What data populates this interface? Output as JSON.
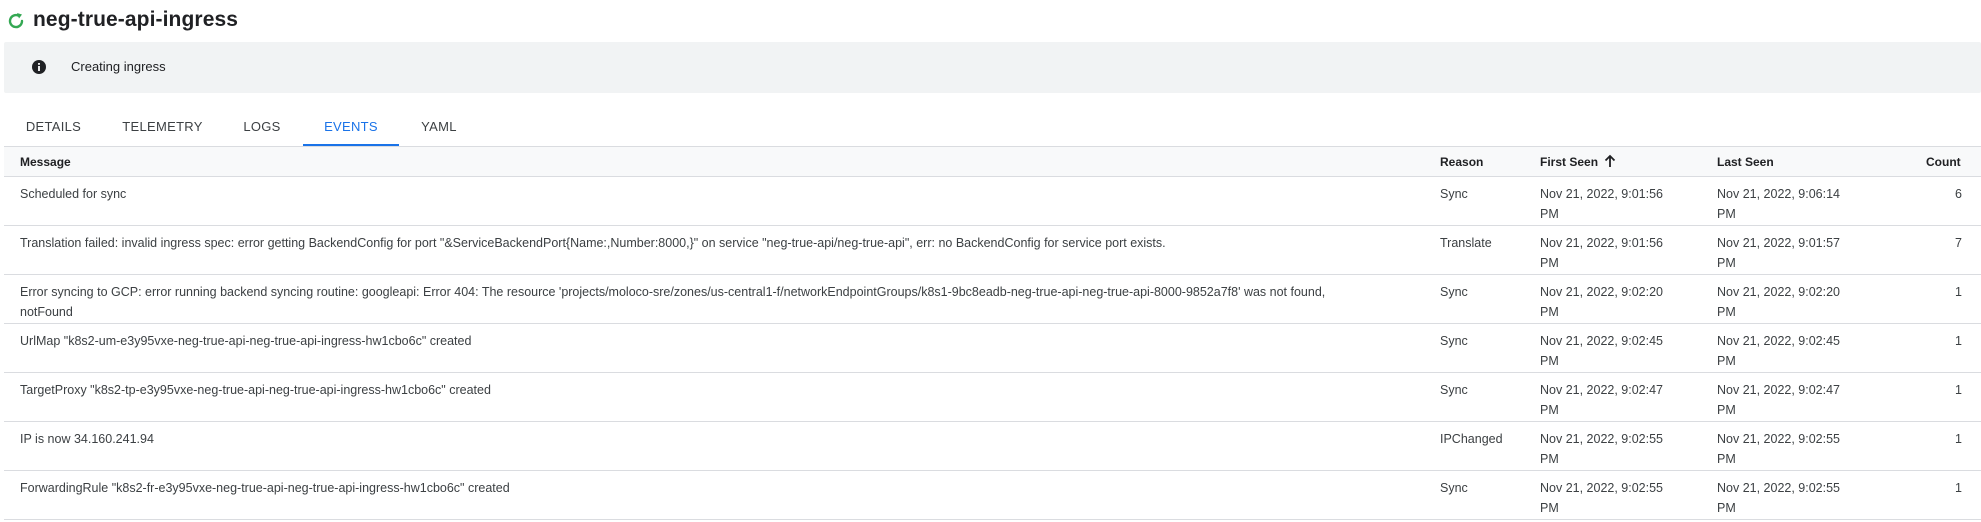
{
  "header": {
    "title": "neg-true-api-ingress",
    "status_icon": "refresh-icon",
    "status_color": "#34a853"
  },
  "banner": {
    "icon": "info-icon",
    "text": "Creating ingress"
  },
  "tabs": [
    {
      "label": "DETAILS",
      "active": false
    },
    {
      "label": "TELEMETRY",
      "active": false
    },
    {
      "label": "LOGS",
      "active": false
    },
    {
      "label": "EVENTS",
      "active": true
    },
    {
      "label": "YAML",
      "active": false
    }
  ],
  "accent_color": "#1a73e8",
  "table": {
    "columns": {
      "message": "Message",
      "reason": "Reason",
      "first_seen": "First Seen",
      "last_seen": "Last Seen",
      "count": "Count"
    },
    "sort_column": "First Seen",
    "sort_direction": "ascending",
    "rows": [
      {
        "message": "Scheduled for sync",
        "reason": "Sync",
        "first_seen": "Nov 21, 2022, 9:01:56 PM",
        "last_seen": "Nov 21, 2022, 9:06:14 PM",
        "count": "6"
      },
      {
        "message": "Translation failed: invalid ingress spec: error getting BackendConfig for port \"&ServiceBackendPort{Name:,Number:8000,}\" on service \"neg-true-api/neg-true-api\", err: no BackendConfig for service port exists.",
        "reason": "Translate",
        "first_seen": "Nov 21, 2022, 9:01:56 PM",
        "last_seen": "Nov 21, 2022, 9:01:57 PM",
        "count": "7"
      },
      {
        "message": "Error syncing to GCP: error running backend syncing routine: googleapi: Error 404: The resource 'projects/moloco-sre/zones/us-central1-f/networkEndpointGroups/k8s1-9bc8eadb-neg-true-api-neg-true-api-8000-9852a7f8' was not found, notFound",
        "reason": "Sync",
        "first_seen": "Nov 21, 2022, 9:02:20 PM",
        "last_seen": "Nov 21, 2022, 9:02:20 PM",
        "count": "1"
      },
      {
        "message": "UrlMap \"k8s2-um-e3y95vxe-neg-true-api-neg-true-api-ingress-hw1cbo6c\" created",
        "reason": "Sync",
        "first_seen": "Nov 21, 2022, 9:02:45 PM",
        "last_seen": "Nov 21, 2022, 9:02:45 PM",
        "count": "1"
      },
      {
        "message": "TargetProxy \"k8s2-tp-e3y95vxe-neg-true-api-neg-true-api-ingress-hw1cbo6c\" created",
        "reason": "Sync",
        "first_seen": "Nov 21, 2022, 9:02:47 PM",
        "last_seen": "Nov 21, 2022, 9:02:47 PM",
        "count": "1"
      },
      {
        "message": "IP is now 34.160.241.94",
        "reason": "IPChanged",
        "first_seen": "Nov 21, 2022, 9:02:55 PM",
        "last_seen": "Nov 21, 2022, 9:02:55 PM",
        "count": "1"
      },
      {
        "message": "ForwardingRule \"k8s2-fr-e3y95vxe-neg-true-api-neg-true-api-ingress-hw1cbo6c\" created",
        "reason": "Sync",
        "first_seen": "Nov 21, 2022, 9:02:55 PM",
        "last_seen": "Nov 21, 2022, 9:02:55 PM",
        "count": "1"
      }
    ]
  }
}
